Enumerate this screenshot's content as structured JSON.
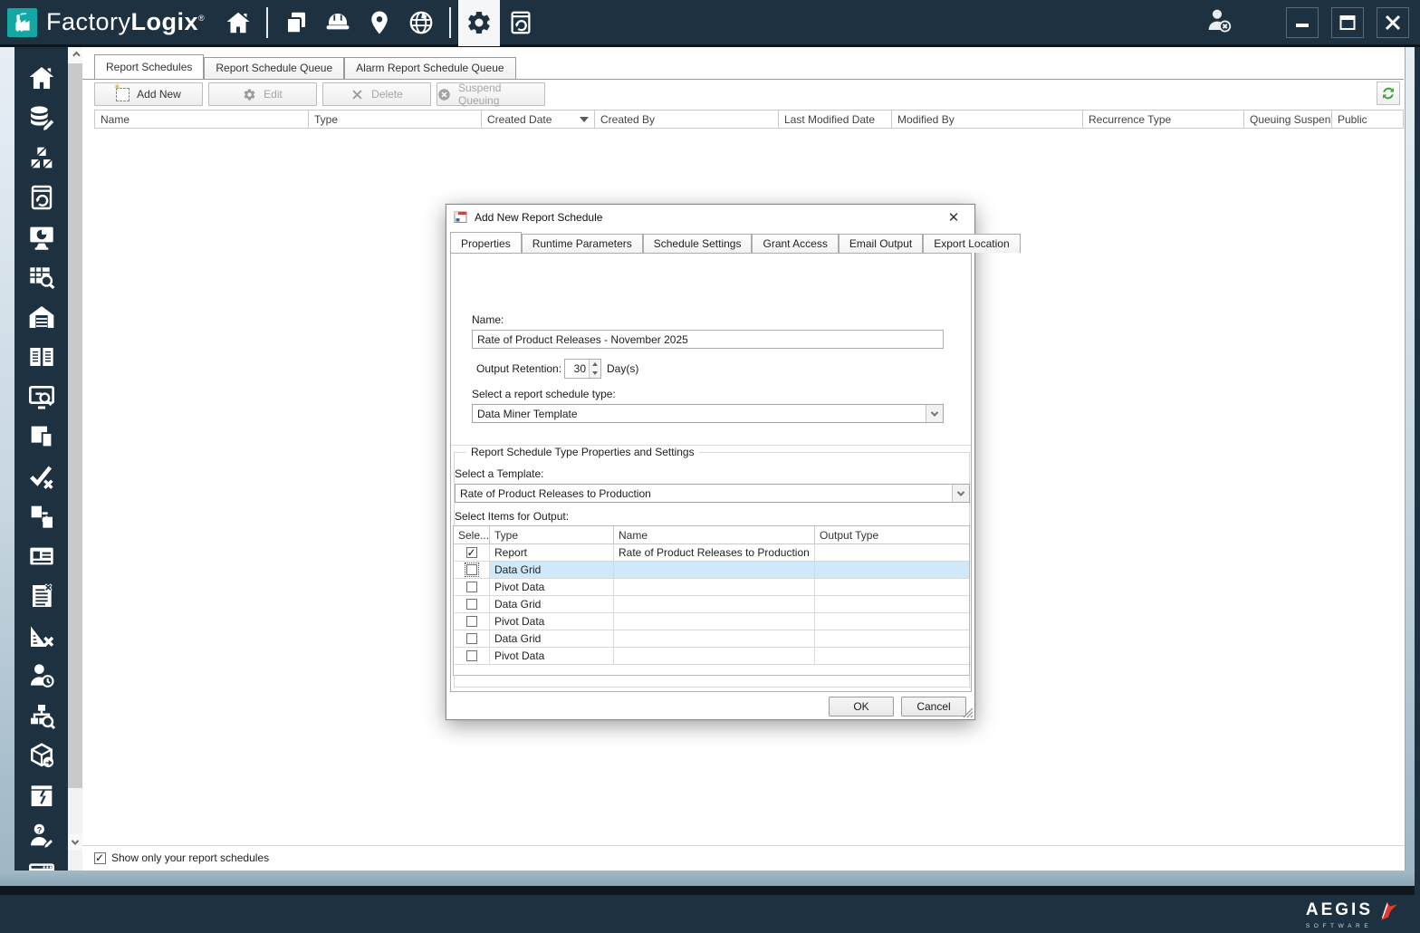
{
  "colors": {
    "chrome_navy": "#1d3140",
    "logo_teal": "#14a7a3",
    "row_highlight": "#cfe8fa",
    "refresh_green": "#45a33c",
    "aegis_red": "#e23b2e"
  },
  "titlebar": {
    "brand_light": "Factory",
    "brand_bold": "Logix",
    "registered": "®"
  },
  "main": {
    "tabs": [
      {
        "label": "Report Schedules"
      },
      {
        "label": "Report Schedule Queue"
      },
      {
        "label": "Alarm Report Schedule Queue"
      }
    ],
    "toolbar": {
      "add_new": "Add New",
      "edit": "Edit",
      "delete": "Delete",
      "suspend": "Suspend Queuing"
    },
    "grid": {
      "columns": [
        "Name",
        "Type",
        "Created Date",
        "Created By",
        "Last Modified Date",
        "Modified By",
        "Recurrence Type",
        "Queuing Suspen...",
        "Public"
      ]
    },
    "show_only_label": "Show only your report schedules",
    "show_only_checked": true
  },
  "dialog": {
    "title": "Add New Report Schedule",
    "tabs": [
      {
        "label": "Properties"
      },
      {
        "label": "Runtime Parameters"
      },
      {
        "label": "Schedule Settings"
      },
      {
        "label": "Grant Access"
      },
      {
        "label": "Email Output"
      },
      {
        "label": "Export Location"
      }
    ],
    "name_label": "Name:",
    "name_value": "Rate of Product Releases - November 2025",
    "retention_label": "Output Retention:",
    "retention_value": "30",
    "retention_unit": "Day(s)",
    "schedule_type_label": "Select a report schedule type:",
    "schedule_type_value": "Data Miner Template",
    "group_title": "Report Schedule Type Properties and Settings",
    "template_label": "Select a Template:",
    "template_value": "Rate of Product Releases to Production",
    "items_label": "Select Items for Output:",
    "items_grid": {
      "columns": [
        "Sele...",
        "Type",
        "Name",
        "Output Type"
      ],
      "rows": [
        {
          "checked": true,
          "type": "Report",
          "name": "Rate of Product Releases to Production",
          "output_type": ""
        },
        {
          "checked": false,
          "type": "Data Grid",
          "name": "",
          "output_type": "",
          "selected": true,
          "focused": true
        },
        {
          "checked": false,
          "type": "Pivot Data",
          "name": "",
          "output_type": ""
        },
        {
          "checked": false,
          "type": "Data Grid",
          "name": "",
          "output_type": ""
        },
        {
          "checked": false,
          "type": "Pivot Data",
          "name": "",
          "output_type": ""
        },
        {
          "checked": false,
          "type": "Data Grid",
          "name": "",
          "output_type": ""
        },
        {
          "checked": false,
          "type": "Pivot Data",
          "name": "",
          "output_type": ""
        }
      ]
    },
    "ok_label": "OK",
    "cancel_label": "Cancel"
  },
  "footer": {
    "brand": "AEGIS",
    "brand_sub": "SOFTWARE"
  }
}
